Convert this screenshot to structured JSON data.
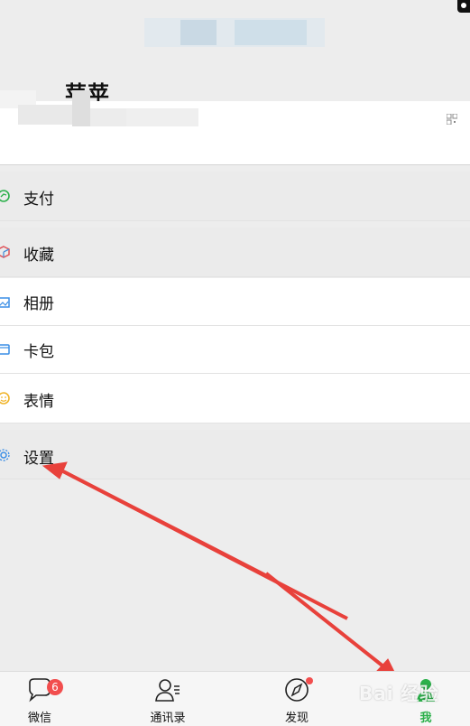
{
  "profile": {
    "name": "苹苹"
  },
  "menu": [
    {
      "key": "pay",
      "label": "支付",
      "icon": "pay-icon"
    },
    {
      "key": "favorites",
      "label": "收藏",
      "icon": "favorites-icon"
    },
    {
      "key": "album",
      "label": "相册",
      "icon": "album-icon"
    },
    {
      "key": "cards",
      "label": "卡包",
      "icon": "card-icon"
    },
    {
      "key": "stickers",
      "label": "表情",
      "icon": "sticker-icon"
    },
    {
      "key": "settings",
      "label": "设置",
      "icon": "gear-icon"
    }
  ],
  "tabbar": [
    {
      "key": "chats",
      "label": "微信",
      "badge": "6"
    },
    {
      "key": "contacts",
      "label": "通讯录"
    },
    {
      "key": "discover",
      "label": "发现"
    },
    {
      "key": "me",
      "label": "我"
    }
  ],
  "watermark": "Bai 经验",
  "colors": {
    "accent_green": "#2bb04a",
    "badge_red": "#f24e4e",
    "annotation_arrow": "#e8413b"
  }
}
